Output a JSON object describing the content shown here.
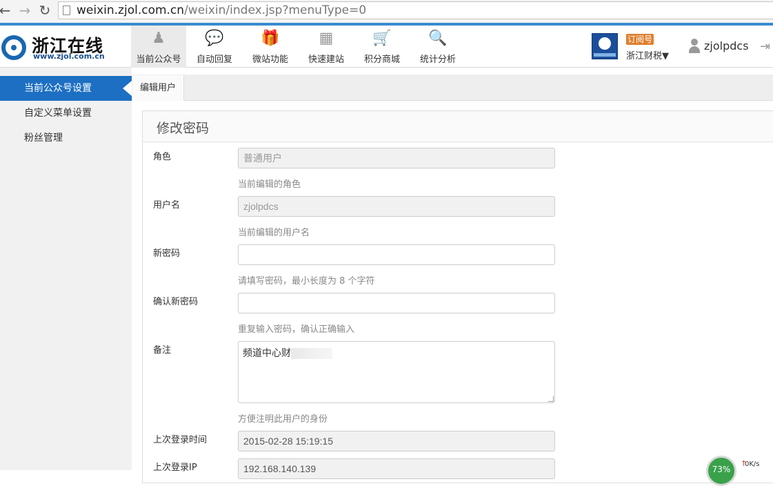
{
  "browser": {
    "url_host": "weixin.zjol.com.cn",
    "url_path": "/weixin/index.jsp?menuType=0"
  },
  "header": {
    "logo_title": "浙江在线",
    "logo_sub": "www.zjol.com.cn",
    "menu": [
      {
        "label": "当前公众号",
        "icon": "users-icon",
        "glyph": "♟"
      },
      {
        "label": "自动回复",
        "icon": "chat-bubbles-icon",
        "glyph": "💬"
      },
      {
        "label": "微站功能",
        "icon": "gift-icon",
        "glyph": "🎁"
      },
      {
        "label": "快速建站",
        "icon": "windows-icon",
        "glyph": "▦"
      },
      {
        "label": "积分商城",
        "icon": "shopping-cart-icon",
        "glyph": "🛒"
      },
      {
        "label": "统计分析",
        "icon": "magnifier-icon",
        "glyph": "🔍"
      }
    ],
    "account_badge": "订阅号",
    "account_name": "浙江财税▼",
    "username": "zjolpdcs"
  },
  "sidebar": {
    "items": [
      {
        "label": "当前公众号设置"
      },
      {
        "label": "自定义菜单设置"
      },
      {
        "label": "粉丝管理"
      }
    ]
  },
  "tabs": [
    {
      "label": "编辑用户"
    }
  ],
  "form": {
    "title": "修改密码",
    "role": {
      "label": "角色",
      "value": "普通用户",
      "help": "当前编辑的角色"
    },
    "username": {
      "label": "用户名",
      "value": "zjolpdcs",
      "help": "当前编辑的用户名"
    },
    "new_password": {
      "label": "新密码",
      "value": "",
      "help": "请填写密码，最小长度为 8 个字符"
    },
    "confirm_password": {
      "label": "确认新密码",
      "value": "",
      "help": "重复输入密码，确认正确输入"
    },
    "note": {
      "label": "备注",
      "value": "频道中心财",
      "help": "方便注明此用户的身份"
    },
    "last_login_time": {
      "label": "上次登录时间",
      "value": "2015-02-28 15:19:15"
    },
    "last_login_ip": {
      "label": "上次登录IP",
      "value": "192.168.140.139"
    }
  },
  "speed_widget": {
    "percent": "73%",
    "rate": "0K/s"
  }
}
